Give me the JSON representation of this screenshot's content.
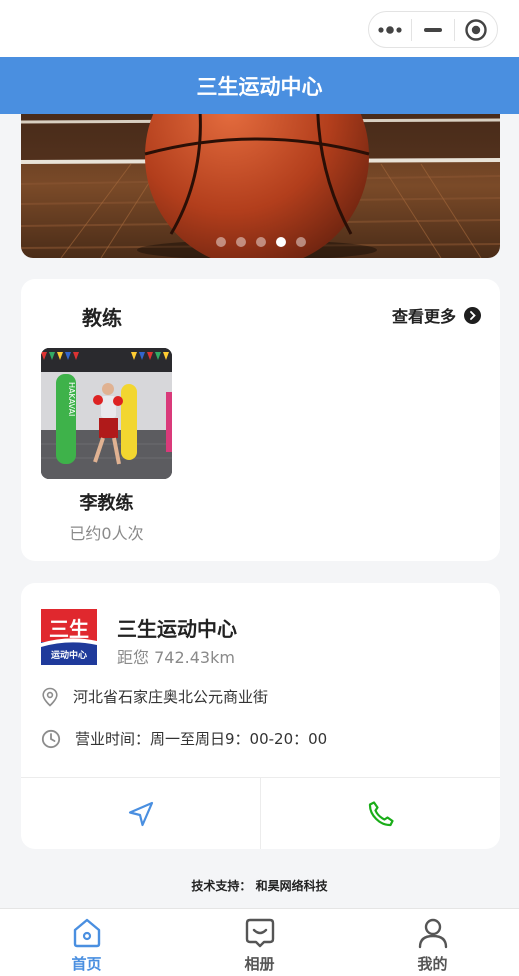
{
  "header": {
    "title": "三生运动中心"
  },
  "banner": {
    "slide_count": 5,
    "active_slide": 4
  },
  "coach_section": {
    "title": "教练",
    "more_label": "查看更多",
    "coaches": [
      {
        "name": "李教练",
        "stat": "已约0人次",
        "bag_text": "HAKAVAI"
      }
    ]
  },
  "store": {
    "logo_top_text": "三生",
    "logo_bottom_text": "运动中心",
    "name": "三生运动中心",
    "distance": "距您 742.43km",
    "address": "河北省石家庄奥北公元商业街",
    "hours": "营业时间：周一至周日9：00-20：00",
    "actions": [
      {
        "name": "navigate",
        "icon": "navigation-arrow-icon"
      },
      {
        "name": "call",
        "icon": "phone-icon"
      }
    ]
  },
  "footer": {
    "support_text": "技术支持：  和昊网络科技"
  },
  "tabbar": {
    "active_index": 0,
    "tabs": [
      {
        "label": "首页",
        "icon": "home-icon"
      },
      {
        "label": "相册",
        "icon": "album-icon"
      },
      {
        "label": "我的",
        "icon": "user-icon"
      }
    ]
  },
  "colors": {
    "primary": "#4a8fe0",
    "phone_green": "#1aad19",
    "logo_red": "#e0282e",
    "logo_blue": "#1f3a9b"
  }
}
